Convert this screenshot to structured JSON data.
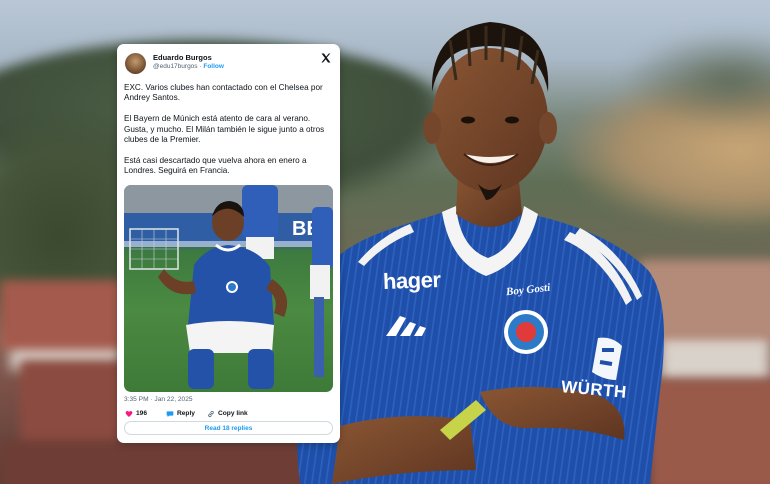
{
  "tweet": {
    "author_name": "Eduardo Burgos",
    "author_handle": "@edu17burgos",
    "separator": " · ",
    "follow_label": "Follow",
    "body": "EXC. Varios clubes han contactado con el Chelsea por Andrey Santos.\n\nEl Bayern de Múnich está atento de cara al verano. Gusta, y mucho. El Milán también le sigue junto a otros clubes de la Premier.\n\nEstá casi descartado que vuelva ahora en enero a Londres. Seguirá en Francia.",
    "timestamp": "3:35 PM · Jan 22, 2025",
    "likes": "196",
    "reply_label": "Reply",
    "copy_link_label": "Copy link",
    "read_replies_label": "Read 18 replies",
    "media_board_text": "BE"
  },
  "shirt": {
    "sponsor_front": "hager",
    "sponsor_sleeve": "WÜRTH",
    "kit_maker_text": "Boy Gosti"
  },
  "colors": {
    "x_accent": "#1d9bf0",
    "like_heart": "#f91880",
    "shirt_blue": "#1f4fa8",
    "collar_white": "#f4f4f4"
  },
  "icons": [
    "x-logo-icon",
    "heart-icon",
    "reply-bubble-icon",
    "link-icon"
  ]
}
